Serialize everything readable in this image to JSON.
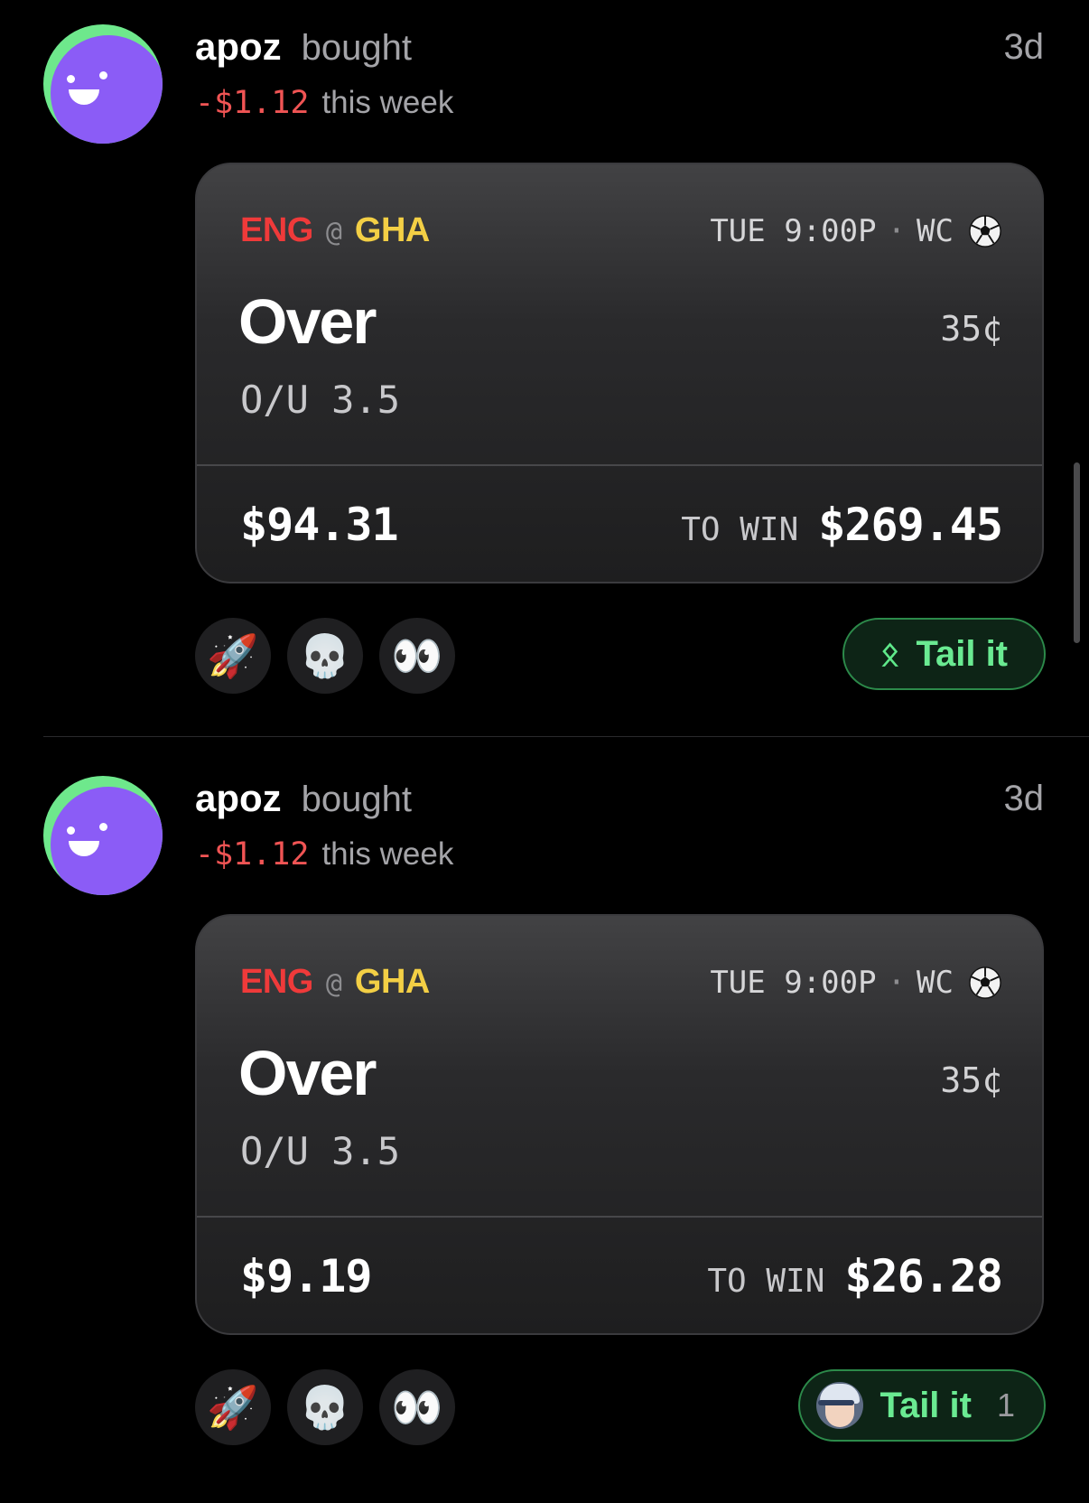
{
  "posts": [
    {
      "user": "apoz",
      "action": "bought",
      "age": "3d",
      "pnl": "-$1.12",
      "period": "this week",
      "bet": {
        "away": "ENG",
        "at": "@",
        "home": "GHA",
        "time": "TUE 9:00P",
        "sep": "·",
        "league": "WC",
        "side": "Over",
        "price": "35¢",
        "market": "O/U 3.5",
        "stake": "$94.31",
        "to_win_label": "TO WIN",
        "payout": "$269.45"
      },
      "reactions": [
        "🚀",
        "💀",
        "👀"
      ],
      "tail": {
        "glyph": "ᛟ",
        "label": "Tail it",
        "count": null
      }
    },
    {
      "user": "apoz",
      "action": "bought",
      "age": "3d",
      "pnl": "-$1.12",
      "period": "this week",
      "bet": {
        "away": "ENG",
        "at": "@",
        "home": "GHA",
        "time": "TUE 9:00P",
        "sep": "·",
        "league": "WC",
        "side": "Over",
        "price": "35¢",
        "market": "O/U 3.5",
        "stake": "$9.19",
        "to_win_label": "TO WIN",
        "payout": "$26.28"
      },
      "reactions": [
        "🚀",
        "💀",
        "👀"
      ],
      "tail": {
        "label": "Tail it",
        "count": "1"
      }
    }
  ],
  "icons": {
    "league_icon": "soccer-ball-icon",
    "reaction_icons": [
      "rocket-icon",
      "skull-icon",
      "eyes-icon"
    ]
  },
  "colors": {
    "background": "#000000",
    "loss": "#f05454",
    "away_team": "#ef3a3a",
    "home_team": "#f3cf45",
    "tail_accent": "#6aea92",
    "avatar_face": "#8b5cf6",
    "avatar_ring": "#6ee88c"
  }
}
